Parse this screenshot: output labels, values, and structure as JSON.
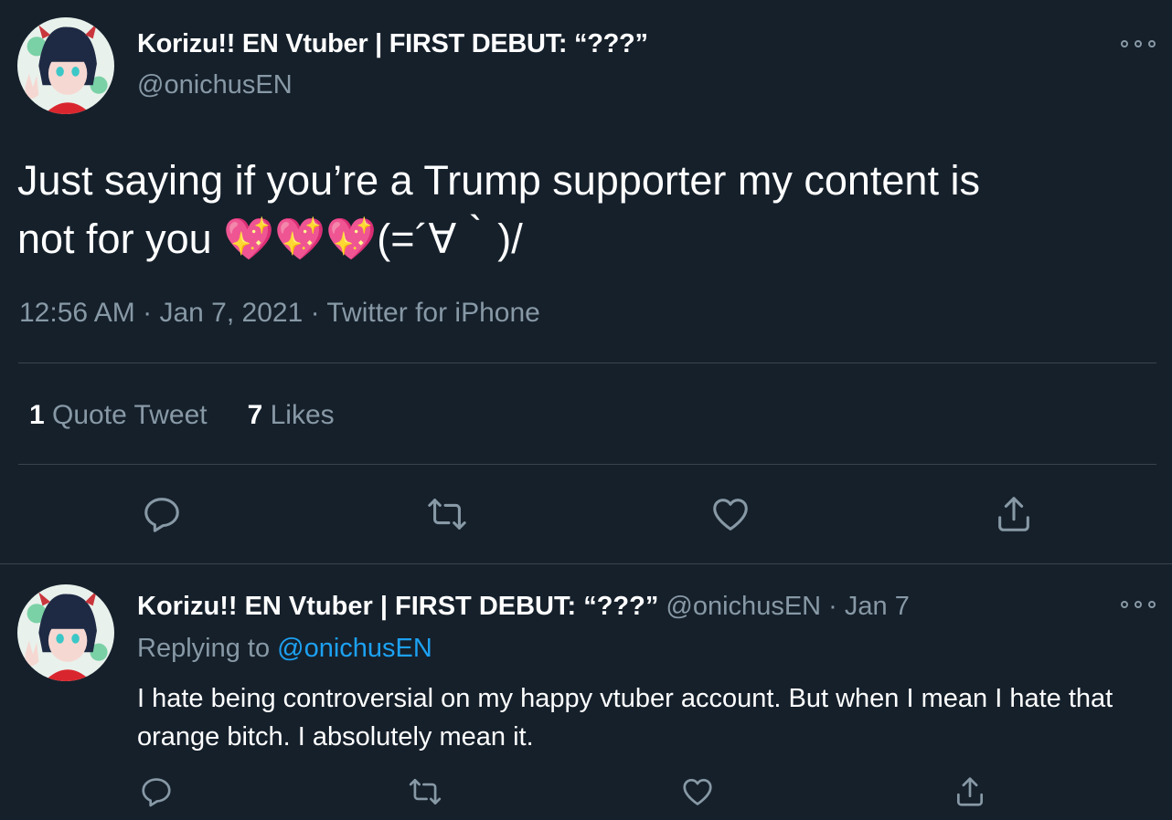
{
  "main_tweet": {
    "author_name": "Korizu!! EN Vtuber | FIRST DEBUT: “???”",
    "author_handle": "@onichusEN",
    "text_line1": "Just saying if you’re a Trump supporter my content is",
    "text_line2_prefix": "not for you ",
    "emojis": "💖💖💖",
    "text_line2_suffix": "(=´∀｀)/",
    "time": "12:56 AM",
    "date": "Jan 7, 2021",
    "source": "Twitter for iPhone",
    "separator": "·",
    "quote_count": "1",
    "quote_label": "Quote Tweet",
    "like_count": "7",
    "like_label": "Likes",
    "actions": [
      "reply-icon",
      "retweet-icon",
      "like-icon",
      "share-icon"
    ]
  },
  "reply_tweet": {
    "author_name": "Korizu!! EN Vtuber | FIRST DEBUT: “???”",
    "author_handle": "@onichusEN",
    "date": "Jan 7",
    "separator": "·",
    "replying_label": "Replying to",
    "replying_handle": "@onichusEN",
    "text": "I hate being controversial on my happy vtuber account. But when I mean I hate that orange bitch. I absolutely mean it.",
    "actions": [
      "reply-icon",
      "retweet-icon",
      "like-icon",
      "share-icon"
    ]
  },
  "colors": {
    "background": "#15202b",
    "text": "#ffffff",
    "muted": "#8899a6",
    "link": "#1da1f2",
    "divider": "#38444d"
  }
}
